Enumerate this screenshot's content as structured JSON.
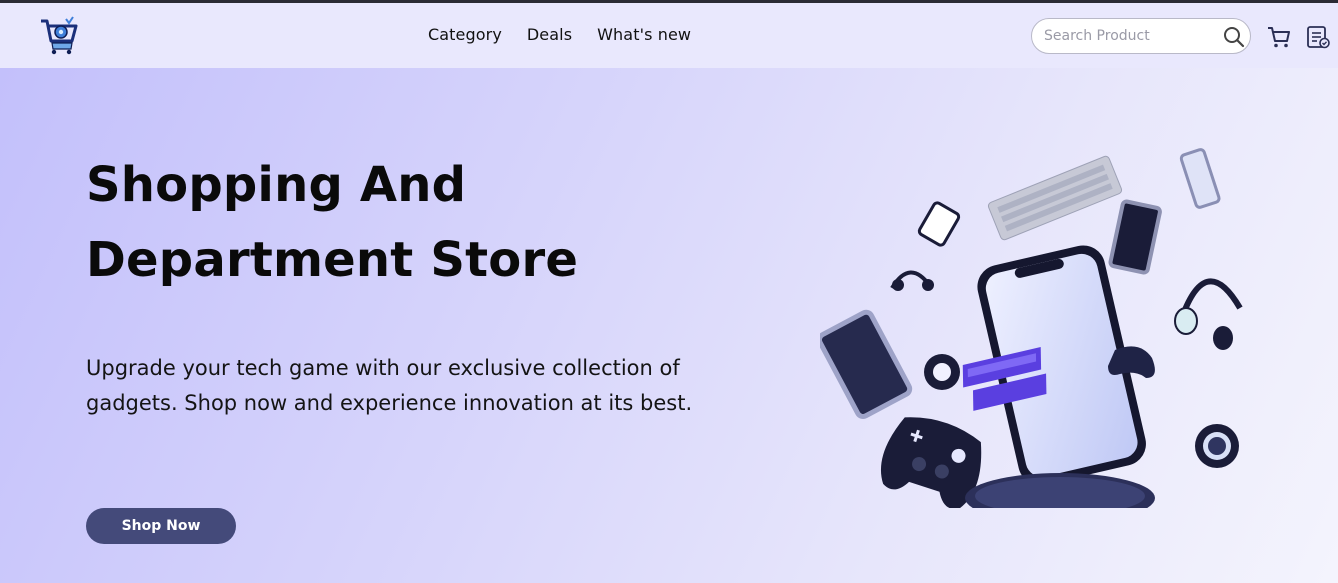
{
  "header": {
    "logo_icon": "shopping-cart-logo",
    "nav": [
      {
        "label": "Category"
      },
      {
        "label": "Deals"
      },
      {
        "label": "What's new"
      }
    ],
    "search": {
      "placeholder": "Search Product",
      "value": "",
      "icon": "search-icon"
    },
    "cart_icon": "cart-icon",
    "orders_icon": "order-list-icon"
  },
  "hero": {
    "title": "Shopping And Department Store",
    "description": "Upgrade your tech game with our exclusive collection of gadgets. Shop now and experience innovation at its best.",
    "cta_label": "Shop Now",
    "image": "gadgets-phone-illustration"
  },
  "colors": {
    "nav_bg": "#e9e8fd",
    "hero_gradient_start": "#c3c0fb",
    "hero_gradient_end": "#f4f4fd",
    "button_bg": "#444a7a",
    "text": "#0a0a0a"
  }
}
